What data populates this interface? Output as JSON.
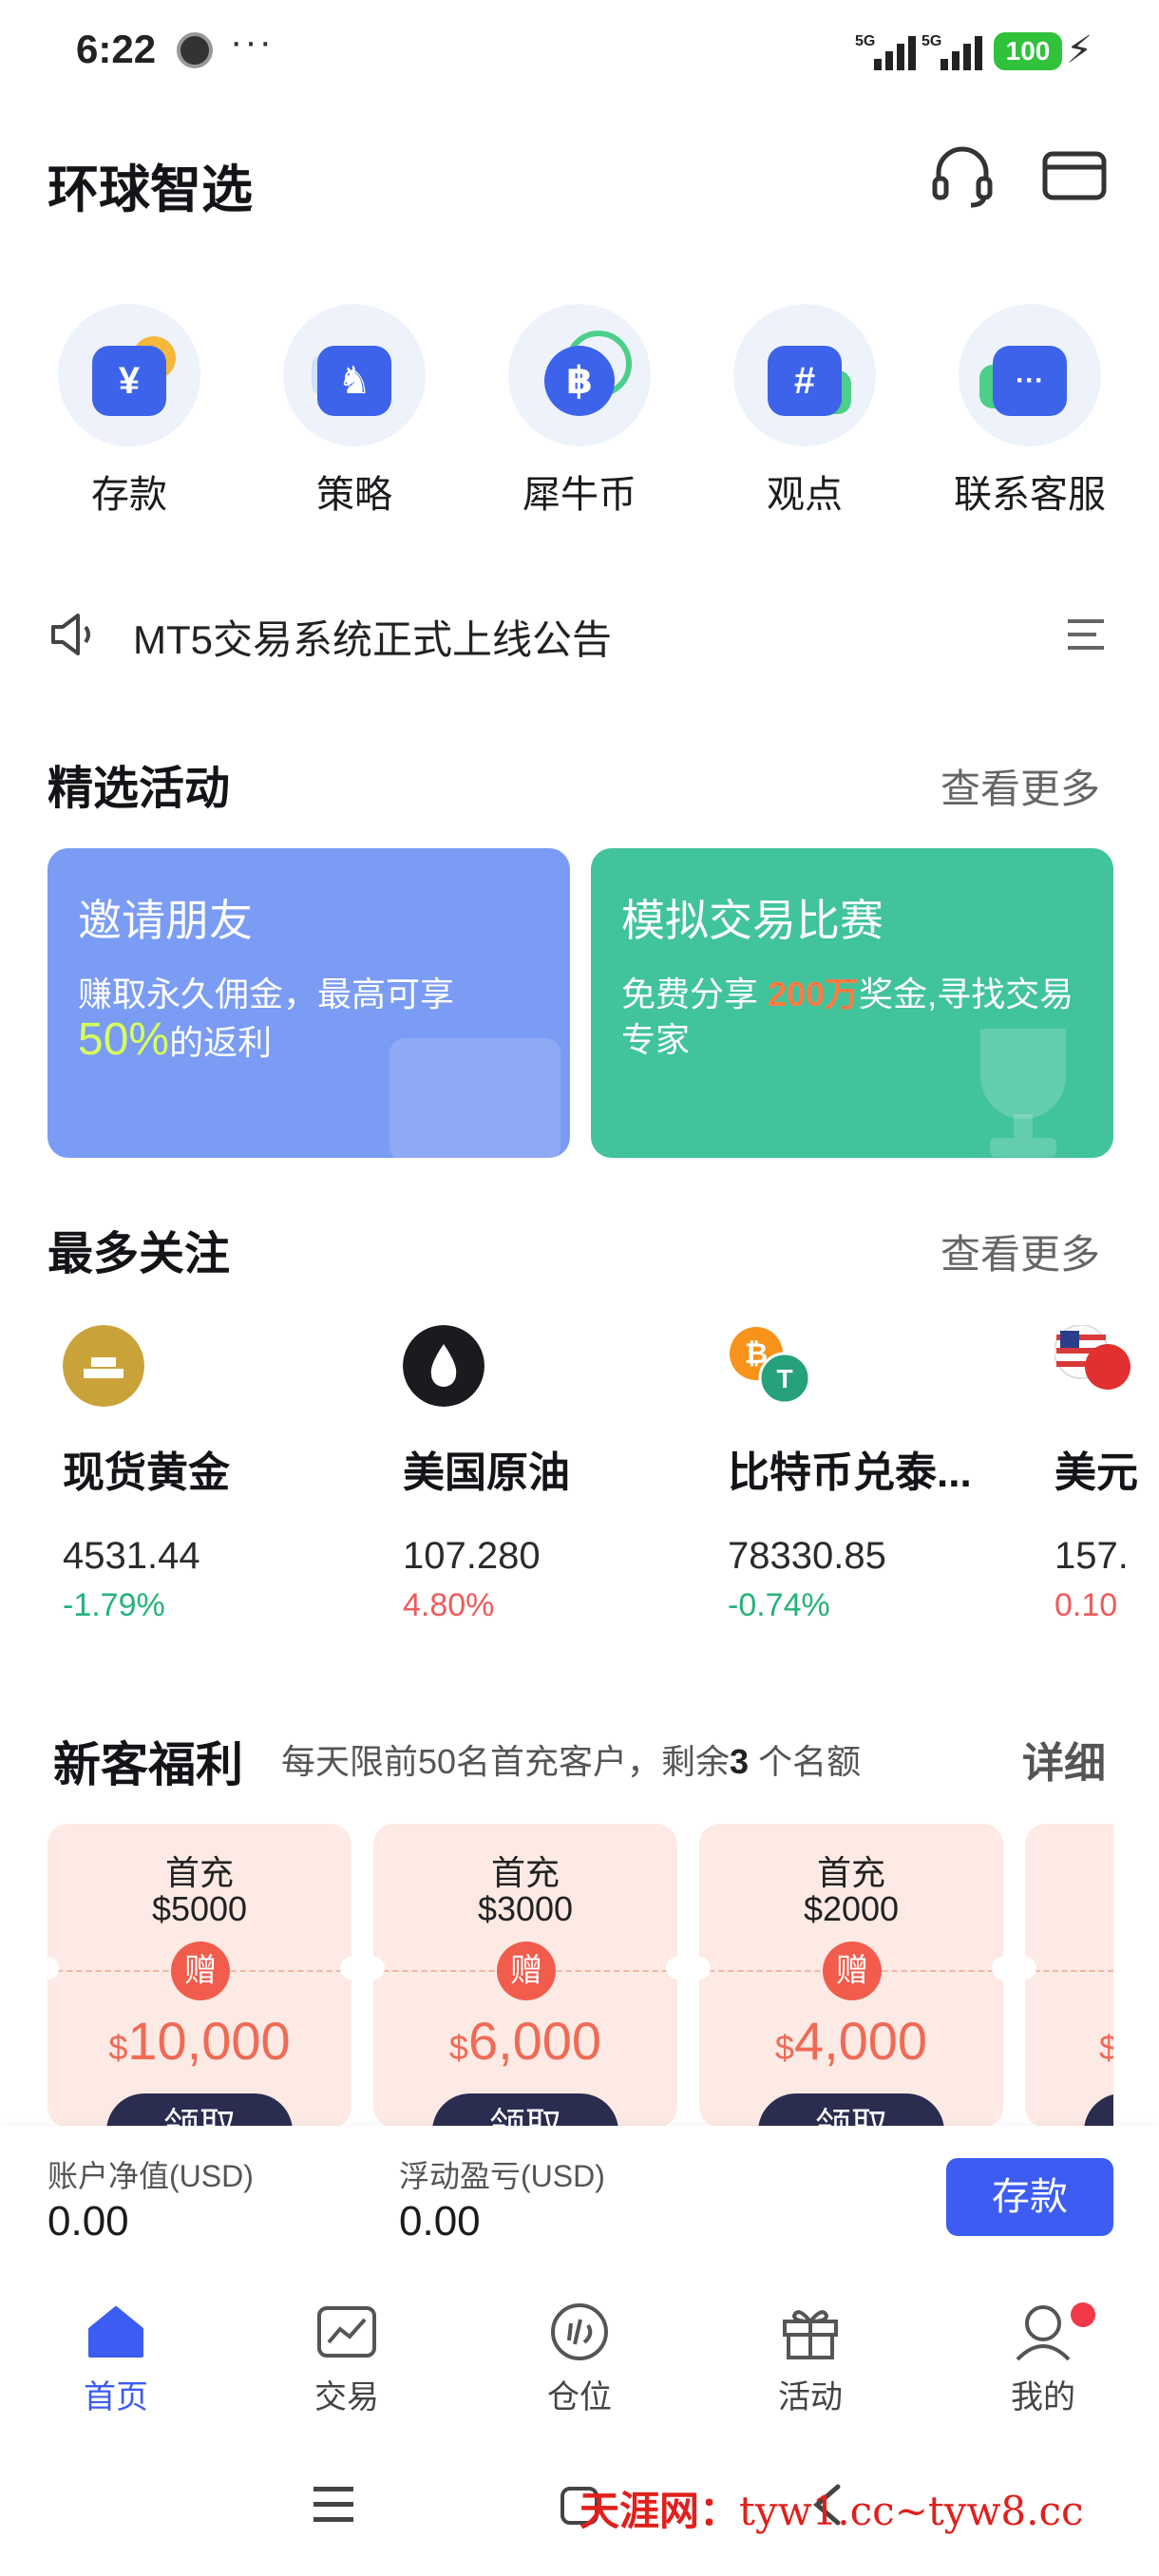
{
  "status": {
    "time": "6:22",
    "more": "···",
    "sig1": "5G",
    "sig2": "5G",
    "battery": "100",
    "bolt": "⚡"
  },
  "header": {
    "title": "环球智选"
  },
  "quick_actions": [
    {
      "label": "存款",
      "icon": "deposit-icon",
      "glyph": "¥"
    },
    {
      "label": "策略",
      "icon": "strategy-icon",
      "glyph": "♞"
    },
    {
      "label": "犀牛币",
      "icon": "coin-icon",
      "glyph": "฿"
    },
    {
      "label": "观点",
      "icon": "hashtag-icon",
      "glyph": "#"
    },
    {
      "label": "联系客服",
      "icon": "chat-icon",
      "glyph": "···"
    }
  ],
  "notice": {
    "text": "MT5交易系统正式上线公告"
  },
  "activities": {
    "title": "精选活动",
    "more": "查看更多",
    "cards": [
      {
        "title": "邀请朋友",
        "desc_a": "赚取永久佣金，最高可享",
        "highlight": "50%",
        "desc_b": "的返利",
        "bg": "#7b9cf4"
      },
      {
        "title": "模拟交易比赛",
        "desc_a": "免费分享 ",
        "highlight": "200万",
        "desc_b": "奖金,寻找交易专家",
        "bg": "#41c39c"
      }
    ]
  },
  "watch": {
    "title": "最多关注",
    "more": "查看更多",
    "items": [
      {
        "name": "现货黄金",
        "price": "4531.44",
        "change": "-1.79%"
      },
      {
        "name": "美国原油",
        "price": "107.280",
        "change": "4.80%"
      },
      {
        "name": "比特币兑泰...",
        "price": "78330.85",
        "change": "-0.74%"
      },
      {
        "name": "美元",
        "price": "157.",
        "change": "0.10"
      }
    ]
  },
  "benefits": {
    "title": "新客福利",
    "subtitle_a": "每天限前50名首充客户，剩余",
    "remaining": "3",
    "subtitle_b": " 个名额",
    "detail": "详细",
    "items": [
      {
        "line1": "首充",
        "line2": "$5000",
        "gift": "赠",
        "currency": "$",
        "amount": "10,000",
        "claim": "领取"
      },
      {
        "line1": "首充",
        "line2": "$3000",
        "gift": "赠",
        "currency": "$",
        "amount": "6,000",
        "claim": "领取"
      },
      {
        "line1": "首充",
        "line2": "$2000",
        "gift": "赠",
        "currency": "$",
        "amount": "4,000",
        "claim": "领取"
      },
      {
        "line1": "",
        "line2": "",
        "gift": "",
        "currency": "$",
        "amount": "",
        "claim": ""
      }
    ]
  },
  "account": {
    "equity_label": "账户净值(USD)",
    "equity_value": "0.00",
    "pnl_label": "浮动盈亏(USD)",
    "pnl_value": "0.00",
    "deposit": "存款"
  },
  "tabs": [
    {
      "label": "首页",
      "active": true
    },
    {
      "label": "交易"
    },
    {
      "label": "仓位"
    },
    {
      "label": "活动"
    },
    {
      "label": "我的"
    }
  ],
  "watermark": {
    "brand": "天涯网：",
    "url": "tyw1.cc~tyw8.cc"
  },
  "colors": {
    "accent": "#3d5cf1",
    "negative": "#25b37a",
    "positive": "#ef5a5a",
    "highlight_orange": "#ff7a45",
    "highlight_lime": "#d8ff5a"
  }
}
